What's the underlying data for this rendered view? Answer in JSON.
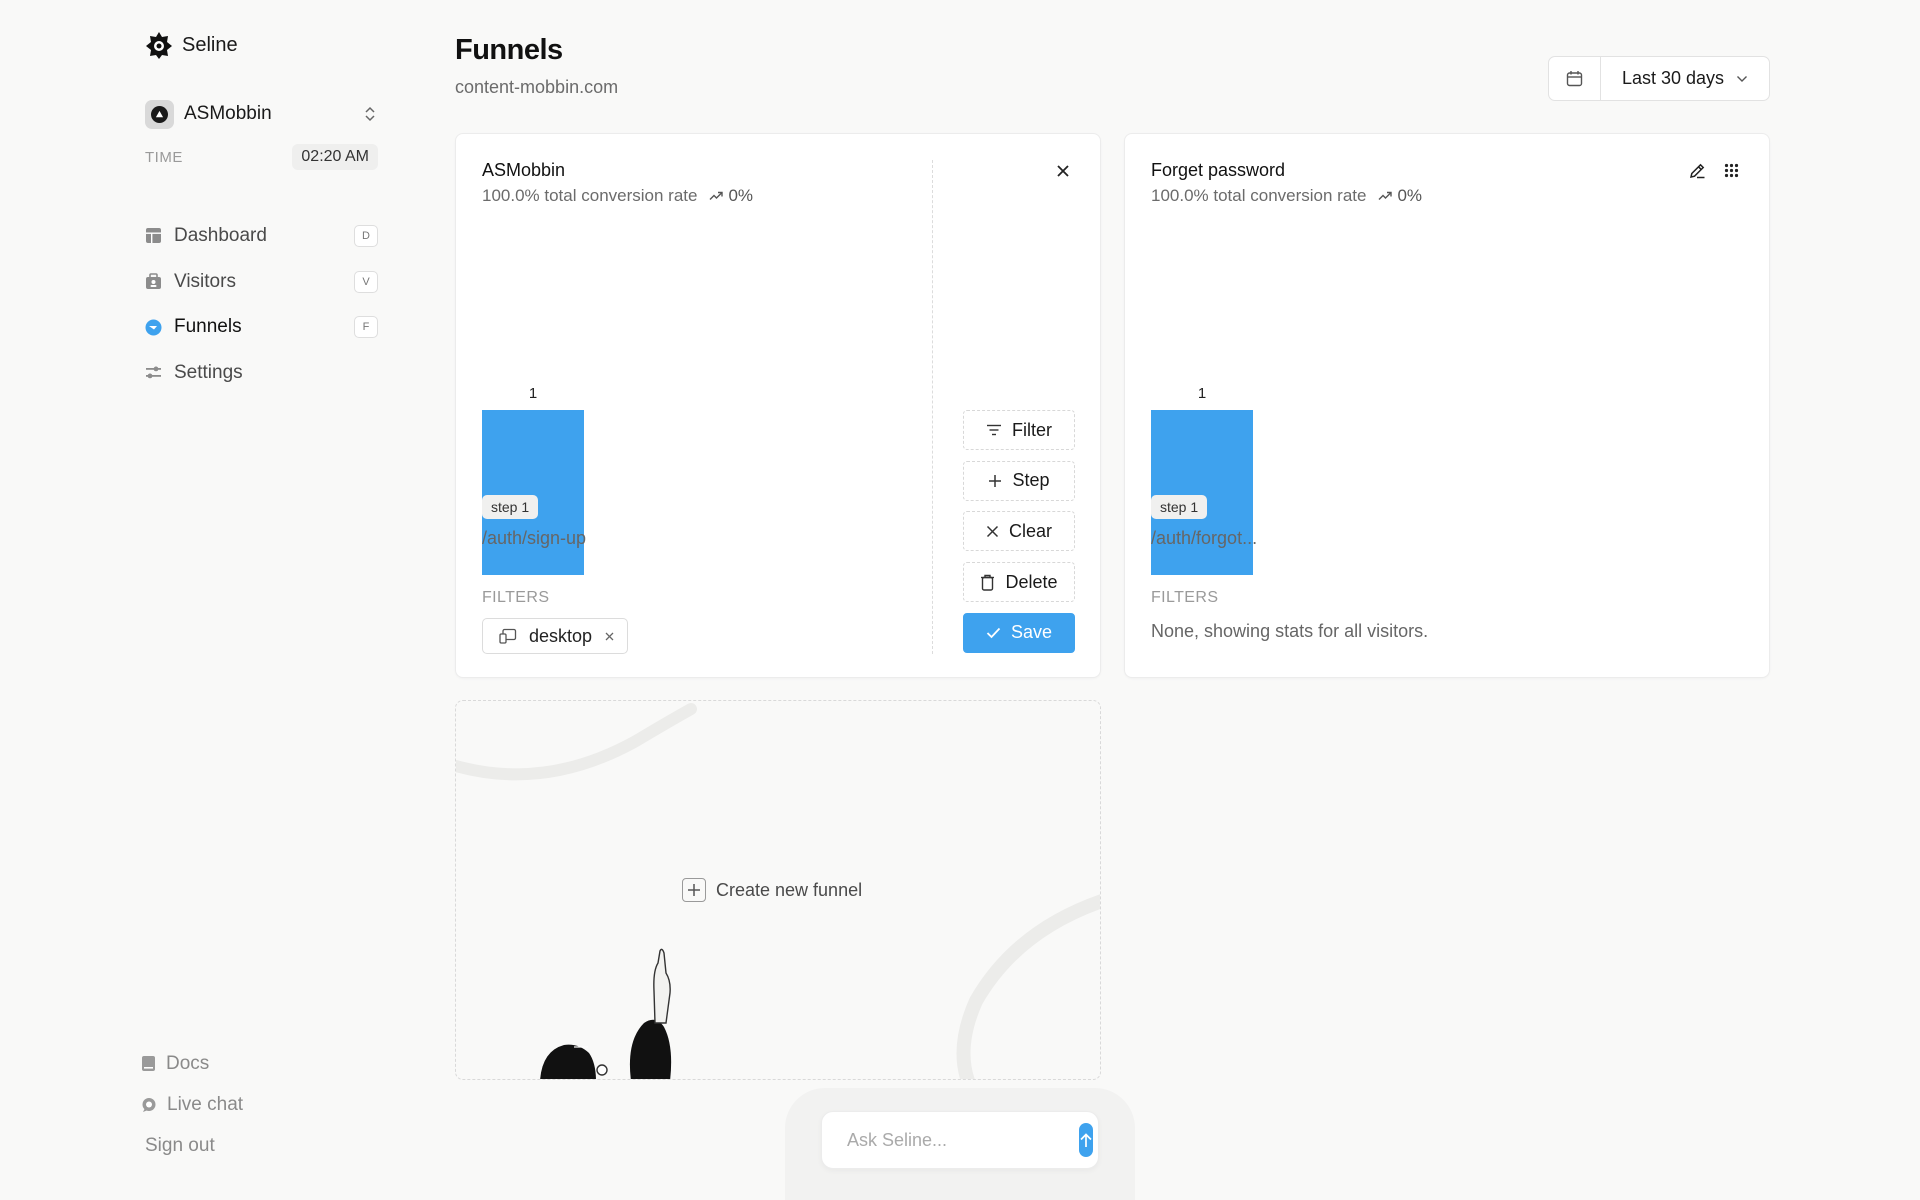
{
  "brand": {
    "name": "Seline"
  },
  "workspace": {
    "name": "ASMobbin"
  },
  "time": {
    "label": "TIME",
    "value": "02:20 AM"
  },
  "nav": {
    "items": [
      {
        "label": "Dashboard",
        "key": "D",
        "icon": "dashboard-icon"
      },
      {
        "label": "Visitors",
        "key": "V",
        "icon": "visitors-icon"
      },
      {
        "label": "Funnels",
        "key": "F",
        "icon": "funnels-icon",
        "active": true
      },
      {
        "label": "Settings",
        "icon": "settings-icon"
      }
    ]
  },
  "bottom": {
    "docs": "Docs",
    "live_chat": "Live chat",
    "sign_out": "Sign out"
  },
  "header": {
    "title": "Funnels",
    "subtitle": "content-mobbin.com",
    "date_range": "Last 30 days"
  },
  "funnels": [
    {
      "title": "ASMobbin",
      "conversion": "100.0% total conversion rate",
      "trend": "0%",
      "step_count_label": "1",
      "step_value_fraction": 1.0,
      "step_badge": "step 1",
      "step_path": "/auth/sign-up",
      "filters_label": "FILTERS",
      "filter_chip": "desktop",
      "actions": {
        "filter": "Filter",
        "step": "Step",
        "clear": "Clear",
        "delete": "Delete",
        "save": "Save"
      }
    },
    {
      "title": "Forget password",
      "conversion": "100.0% total conversion rate",
      "trend": "0%",
      "step_count_label": "1",
      "step_value_fraction": 1.0,
      "step_badge": "step 1",
      "step_path": "/auth/forgot...",
      "filters_label": "FILTERS",
      "filters_none": "None, showing stats for all visitors."
    }
  ],
  "create": {
    "label": "Create new funnel"
  },
  "ask": {
    "placeholder": "Ask Seline..."
  },
  "colors": {
    "accent": "#3ea2ee",
    "background": "#f9f9f8"
  }
}
